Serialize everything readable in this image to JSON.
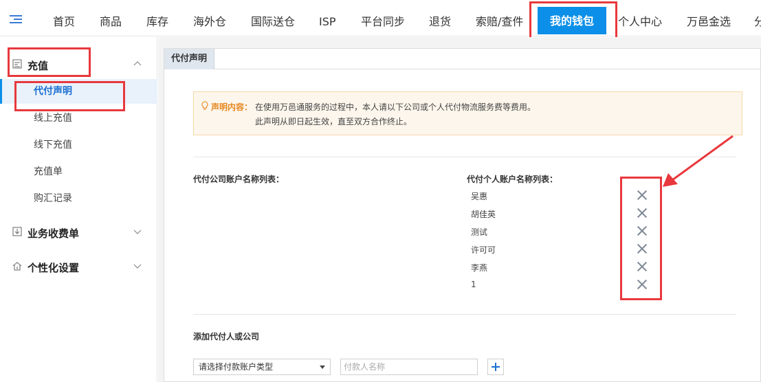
{
  "topnav": {
    "items": [
      "首页",
      "商品",
      "库存",
      "海外仓",
      "国际送仓",
      "ISP",
      "平台同步",
      "退货",
      "索赔/查件",
      "我的钱包",
      "个人中心",
      "万邑金选",
      "分"
    ],
    "active_index": 9
  },
  "sidebar": {
    "groups": [
      {
        "label": "充值",
        "expanded": true,
        "items": [
          "代付声明",
          "线上充值",
          "线下充值",
          "充值单",
          "购汇记录"
        ]
      },
      {
        "label": "业务收费单",
        "expanded": false
      },
      {
        "label": "个性化设置",
        "expanded": false
      }
    ],
    "active_item": "代付声明"
  },
  "main": {
    "tab": "代付声明",
    "notice": {
      "label": "声明内容：",
      "line1": "在使用万邑通服务的过程中，本人请以下公司或个人代付物流服务费等费用。",
      "line2": "此声明从即日起生效，直至双方合作终止。"
    },
    "company_list_title": "代付公司账户名称列表：",
    "person_list_title": "代付个人账户名称列表：",
    "persons": [
      "吴惠",
      "胡佳英",
      "测试",
      "许可可",
      "李燕",
      "1"
    ],
    "add_section_title": "添加代付人或公司",
    "account_type_select": "请选择付款账户类型",
    "payer_name_placeholder": "付款人名称"
  },
  "colors": {
    "accent": "#0c8fe8",
    "highlight": "#e8383d",
    "notice_bg": "#fdf6ec",
    "notice_label": "#e6871f"
  }
}
